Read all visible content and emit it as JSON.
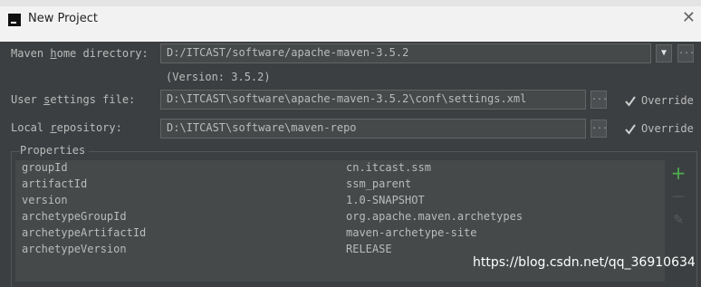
{
  "window": {
    "title": "New Project",
    "close_glyph": "✕"
  },
  "maven": {
    "home_label_pre": "Maven ",
    "home_label_mnemonic": "h",
    "home_label_post": "ome directory:",
    "home_value": "D:/ITCAST/software/apache-maven-3.5.2",
    "version_text": "(Version: 3.5.2)",
    "dropdown_glyph": "▼",
    "browse_glyph": "..."
  },
  "settings": {
    "label_pre": "User ",
    "label_mnemonic": "s",
    "label_post": "ettings file:",
    "value": "D:\\ITCAST\\software\\apache-maven-3.5.2\\conf\\settings.xml",
    "browse_glyph": "...",
    "override_label": "Override",
    "override_checked": true
  },
  "repository": {
    "label_pre": "Local ",
    "label_mnemonic": "r",
    "label_post": "epository:",
    "value": "D:\\ITCAST\\software\\maven-repo",
    "browse_glyph": "...",
    "override_label": "Override",
    "override_checked": true
  },
  "properties": {
    "title": "Properties",
    "rows": [
      {
        "key": "groupId",
        "value": "cn.itcast.ssm"
      },
      {
        "key": "artifactId",
        "value": "ssm_parent"
      },
      {
        "key": "version",
        "value": "1.0-SNAPSHOT"
      },
      {
        "key": "archetypeGroupId",
        "value": "org.apache.maven.archetypes"
      },
      {
        "key": "archetypeArtifactId",
        "value": "maven-archetype-site"
      },
      {
        "key": "archetypeVersion",
        "value": "RELEASE"
      }
    ],
    "add_glyph": "+",
    "remove_glyph": "—",
    "edit_glyph": "✎"
  },
  "watermark": "https://blog.csdn.net/qq_36910634",
  "colors": {
    "accent_add": "#4caf50",
    "checkbox_mark": "#cfcfcf"
  }
}
